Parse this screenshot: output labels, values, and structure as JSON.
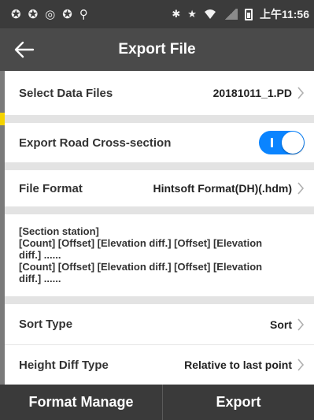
{
  "status_bar": {
    "left_icons": [
      "sync-icon",
      "sync-icon",
      "clock-icon",
      "sync-icon",
      "location-icon"
    ],
    "left_glyphs": [
      "✪",
      "✪",
      "◎",
      "✪",
      "⚲"
    ],
    "bluetooth": "✱",
    "star": "★",
    "time": "上午11:56"
  },
  "title_bar": {
    "title": "Export File"
  },
  "rows": {
    "select_data_files": {
      "label": "Select Data Files",
      "value": "20181011_1.PD"
    },
    "export_road_cross_section": {
      "label": "Export Road Cross-section",
      "enabled": true
    },
    "file_format": {
      "label": "File Format",
      "value": "Hintsoft Format(DH)(.hdm)"
    },
    "sort_type": {
      "label": "Sort Type",
      "value": "Sort"
    },
    "height_diff_type": {
      "label": "Height Diff Type",
      "value": "Relative to last point"
    }
  },
  "format_description": {
    "lines": [
      "[Section station]",
      "[Count] [Offset] [Elevation diff.] [Offset] [Elevation",
      "diff.] ......",
      "[Count] [Offset] [Elevation diff.] [Offset] [Elevation",
      "diff.] ......"
    ]
  },
  "bottom_bar": {
    "format_manage_label": "Format Manage",
    "export_label": "Export"
  },
  "colors": {
    "status_bar_bg": "#3b3b3b",
    "title_bar_bg": "#4a4a4a",
    "toggle_on": "#0a84ff",
    "bottom_bar_bg": "#3a3a3a",
    "page_bg": "#e3e3e3"
  }
}
